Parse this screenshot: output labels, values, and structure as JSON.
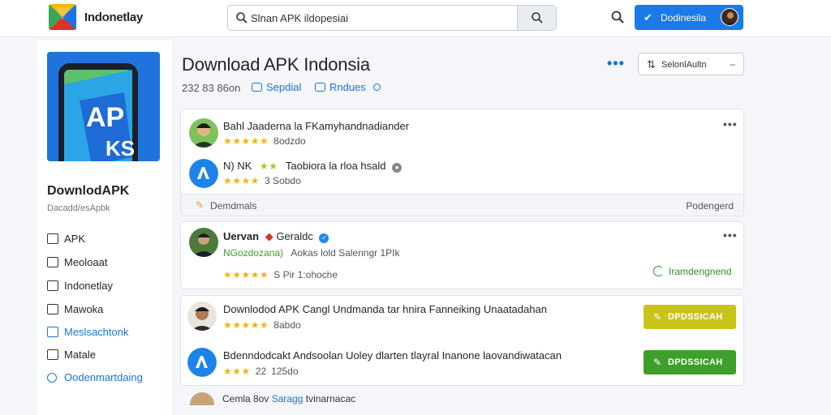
{
  "header": {
    "brand": "Indonetlay",
    "search_value": "Slnan APK ildopesiai",
    "cta_label": "Dodinesila",
    "colors": {
      "accent": "#1a7ae8",
      "background": "#f4f6f9"
    }
  },
  "sidebar": {
    "title": "DownlodAPK",
    "subtitle": "Dacadd/esApbk",
    "items": [
      {
        "label": "APK",
        "icon": "screen-icon"
      },
      {
        "label": "Meoloaat",
        "icon": "edit-icon"
      },
      {
        "label": "Indonetlay",
        "icon": "edit-icon"
      },
      {
        "label": "Mawoka",
        "icon": "edit-icon"
      },
      {
        "label": "Meslsachtonk",
        "icon": "edit-icon",
        "active": true
      },
      {
        "label": "Matale",
        "icon": "edit-icon"
      },
      {
        "label": "Oodenmartdaing",
        "icon": "cloud-icon",
        "active": true
      }
    ]
  },
  "main": {
    "title": "Download APK Indonsia",
    "sort_label": "SelonlAultn",
    "count": "232 83 86on",
    "link_a": "Sepdial",
    "link_b": "Rndues",
    "cards": [
      {
        "rows": [
          {
            "title": "Bahl Jaaderna la FKamyhandnadiander",
            "stars": "★★★★★",
            "sub": "8odzdo"
          },
          {
            "title": "N) NK",
            "title_stars": "★★",
            "title_rest": "Taobiora la rloa hsald",
            "stars": "★★★★",
            "sub": "3 Sobdo"
          }
        ],
        "footer_left": "Demdmals",
        "footer_right": "Podengerd"
      },
      {
        "rows": [
          {
            "title": "Uervan",
            "title_rest": "Geraldc",
            "tag": "NGozdozana)",
            "tag_rest": "Aokas lold Salenngr 1PIk",
            "stars": "★★★★★",
            "sub": "S Pir 1:ohoche"
          }
        ],
        "status": "Iramdengnend"
      },
      {
        "rows": [
          {
            "title": "Downlodod APK Cangl Undmanda tar hnira Fanneiking Unaatadahan",
            "stars": "★★★★★",
            "sub": "8abdo"
          },
          {
            "title": "Bdenndodcakt Andsoolan Uoley dlarten tlayral Inanone laovandiwatacan",
            "stars": "★★★",
            "sub_prefix": "22",
            "sub": "125do"
          }
        ],
        "download_labels": [
          "DPDSSICAH",
          "DPDSSICAH"
        ]
      }
    ],
    "bottom": {
      "text": "Cemla 8ov",
      "link": "Saragg",
      "rest": "tvinarnacac"
    }
  }
}
